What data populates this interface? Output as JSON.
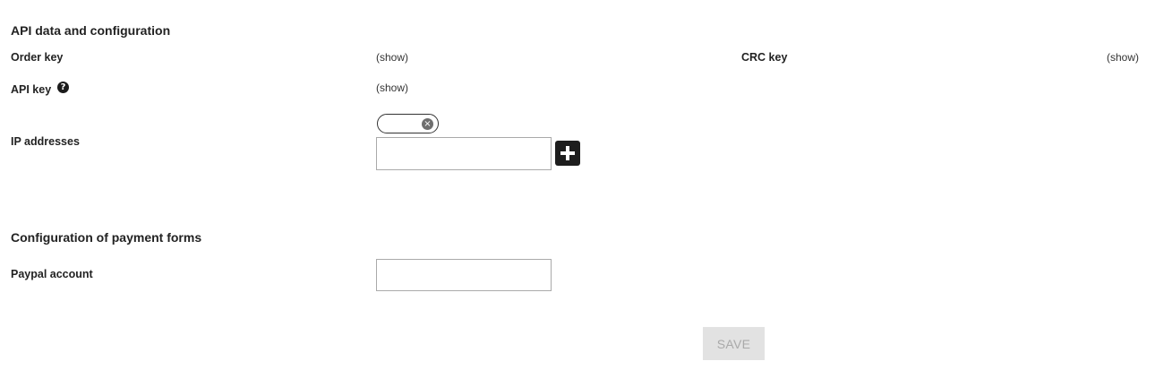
{
  "api_section": {
    "title": "API data and configuration",
    "order_key": {
      "label": "Order key",
      "action": "(show)"
    },
    "crc_key": {
      "label": "CRC key",
      "action": "(show)"
    },
    "api_key": {
      "label": "API key",
      "action": "(show)",
      "help_icon": "question-icon",
      "help_glyph": "?"
    },
    "ip_addresses": {
      "label": "IP addresses",
      "chip_value": "",
      "chip_remove_icon": "close-icon",
      "chip_remove_glyph": "×",
      "input_value": "",
      "add_icon": "plus-icon"
    }
  },
  "payment_section": {
    "title": "Configuration of payment forms",
    "paypal_account": {
      "label": "Paypal account",
      "input_value": ""
    }
  },
  "actions": {
    "save_label": "SAVE",
    "save_disabled": true
  }
}
